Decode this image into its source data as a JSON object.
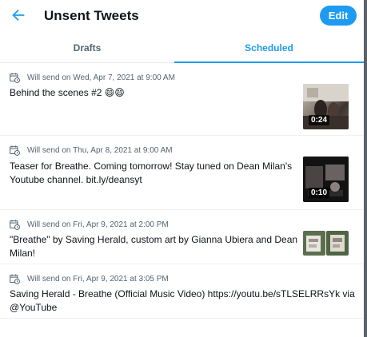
{
  "header": {
    "title": "Unsent Tweets",
    "edit_label": "Edit"
  },
  "tabs": [
    {
      "label": "Drafts",
      "active": false
    },
    {
      "label": "Scheduled",
      "active": true
    }
  ],
  "colors": {
    "accent": "#1d9bf0",
    "text": "#0f1419",
    "secondary_text": "#536471"
  },
  "scheduled": [
    {
      "schedule": "Will send on Wed, Apr 7, 2021 at 9:00 AM",
      "text": "Behind the scenes #2 😄😄",
      "media": {
        "type": "video",
        "duration": "0:24"
      }
    },
    {
      "schedule": "Will send on Thu, Apr 8, 2021 at 9:00 AM",
      "text": "Teaser for Breathe. Coming tomorrow! Stay tuned on Dean Milan's\nYoutube channel. bit.ly/deansyt",
      "media": {
        "type": "video",
        "duration": "0:10"
      }
    },
    {
      "schedule": "Will send on Fri, Apr 9, 2021 at 2:00 PM",
      "text": "\"Breathe\" by Saving Herald, custom art by Gianna Ubiera and Dean\nMilan!",
      "media": {
        "type": "images",
        "count": 2
      }
    },
    {
      "schedule": "Will send on Fri, Apr 9, 2021 at 3:05 PM",
      "text": "Saving Herald - Breathe (Official Music Video) https://youtu.be/sTLSELRRsYk via\n@YouTube",
      "media": null
    }
  ]
}
